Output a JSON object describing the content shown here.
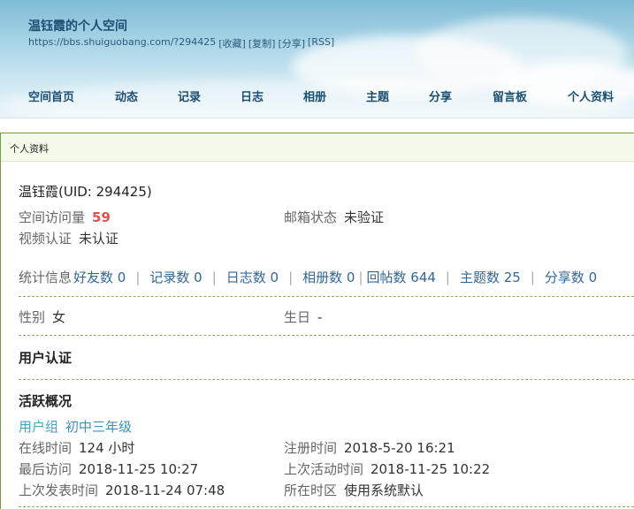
{
  "header": {
    "title": "温钰霞的个人空间",
    "url": "https://bbs.shuiguobang.com/?294425",
    "actions": [
      "[收藏]",
      "[复制]",
      "[分享]",
      "[RSS]"
    ]
  },
  "nav": {
    "items": [
      "空间首页",
      "动态",
      "记录",
      "日志",
      "相册",
      "主题",
      "分享",
      "留言板",
      "个人资料"
    ]
  },
  "panel": {
    "title": "个人资料"
  },
  "profile": {
    "name_uid": "温钰霞(UID: 294425)",
    "visits_label": "空间访问量",
    "visits_value": "59",
    "email_label": "邮箱状态",
    "email_value": "未验证",
    "video_label": "视频认证",
    "video_value": "未认证"
  },
  "stats": {
    "label": "统计信息",
    "items": [
      "好友数 0",
      "记录数 0",
      "日志数 0",
      "相册数 0",
      "回帖数 644",
      "主题数 25",
      "分享数 0"
    ]
  },
  "basic": {
    "gender_label": "性别",
    "gender_value": "女",
    "birthday_label": "生日",
    "birthday_value": "-"
  },
  "auth": {
    "title": "用户认证"
  },
  "activity": {
    "title": "活跃概况",
    "group_label": "用户组",
    "group_value": "初中三年级",
    "online_label": "在线时间",
    "online_value": "124 小时",
    "register_label": "注册时间",
    "register_value": "2018-5-20 16:21",
    "last_visit_label": "最后访问",
    "last_visit_value": "2018-11-25 10:27",
    "last_active_label": "上次活动时间",
    "last_active_value": "2018-11-25 10:22",
    "last_post_label": "上次发表时间",
    "last_post_value": "2018-11-24 07:48",
    "timezone_label": "所在时区",
    "timezone_value": "使用系统默认"
  },
  "colors": {
    "nav_text": "#1d4f72",
    "visits_number": "#d9534f",
    "link": "#336699",
    "panel_border": "#6ea33a"
  }
}
